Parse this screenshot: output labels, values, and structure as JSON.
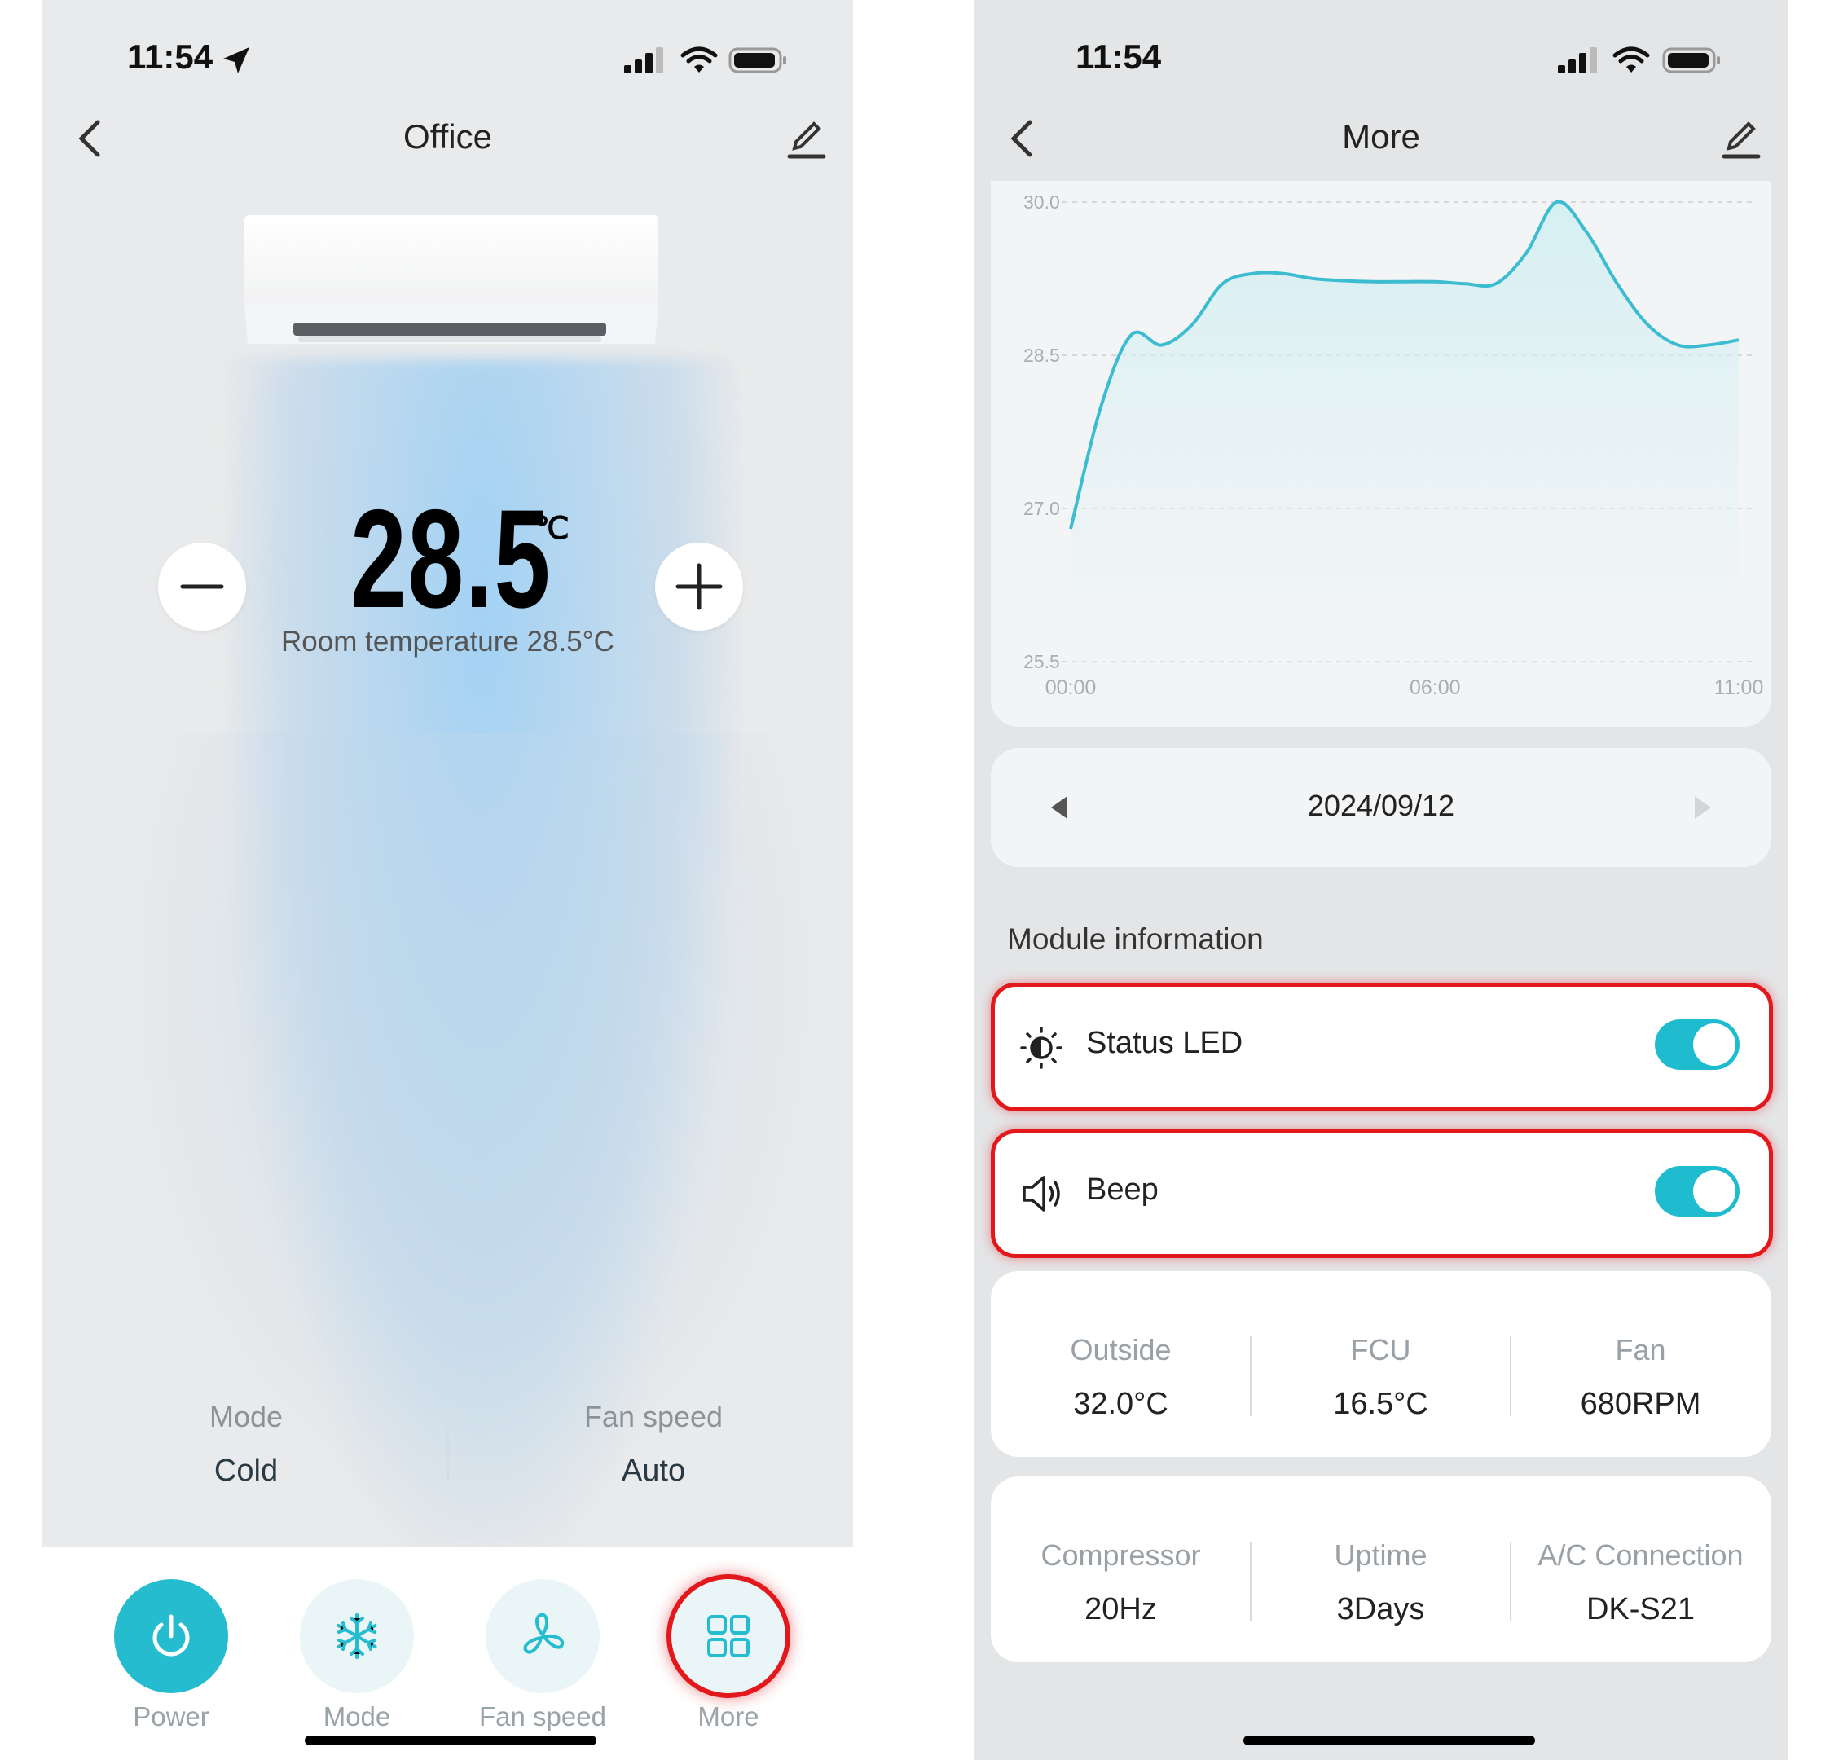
{
  "left_screen": {
    "status": {
      "time": "11:54"
    },
    "nav": {
      "title": "Office"
    },
    "setpoint": {
      "value": "28.5",
      "unit": "℃"
    },
    "room_temperature": "Room temperature 28.5°C",
    "info": [
      {
        "label": "Mode",
        "value": "Cold"
      },
      {
        "label": "Fan speed",
        "value": "Auto"
      }
    ],
    "tabs": [
      {
        "label": "Power",
        "icon": "power-icon"
      },
      {
        "label": "Mode",
        "icon": "snowflake-icon"
      },
      {
        "label": "Fan speed",
        "icon": "fan-icon"
      },
      {
        "label": "More",
        "icon": "grid-icon"
      }
    ]
  },
  "right_screen": {
    "status": {
      "time": "11:54"
    },
    "nav": {
      "title": "More"
    },
    "chart_data": {
      "type": "area",
      "x": [
        "00:00",
        "00:30",
        "01:00",
        "01:30",
        "02:00",
        "02:30",
        "03:00",
        "03:30",
        "04:00",
        "04:30",
        "05:00",
        "05:30",
        "06:00",
        "06:30",
        "07:00",
        "07:30",
        "08:00",
        "08:30",
        "09:00",
        "09:30",
        "10:00",
        "10:30",
        "11:00"
      ],
      "y_ticks": [
        "30.0",
        "28.5",
        "27.0",
        "25.5"
      ],
      "x_ticks": [
        "00:00",
        "06:00",
        "11:00"
      ],
      "ylim": [
        25.5,
        30.0
      ],
      "series": [
        {
          "values": [
            26.8,
            28.0,
            28.7,
            28.6,
            28.8,
            29.2,
            29.3,
            29.3,
            29.25,
            29.23,
            29.22,
            29.22,
            29.22,
            29.2,
            29.2,
            29.5,
            30.0,
            29.7,
            29.2,
            28.8,
            28.6,
            28.6,
            28.65
          ]
        }
      ],
      "grid": true,
      "line_color": "#3cbcd0"
    },
    "date_picker": {
      "date": "2024/09/12"
    },
    "section_title": "Module information",
    "toggles": [
      {
        "label": "Status LED",
        "icon": "brightness-icon",
        "on": true
      },
      {
        "label": "Beep",
        "icon": "speaker-icon",
        "on": true
      }
    ],
    "stats_row1": [
      {
        "label": "Outside",
        "value": "32.0°C"
      },
      {
        "label": "FCU",
        "value": "16.5°C"
      },
      {
        "label": "Fan",
        "value": "680RPM"
      }
    ],
    "stats_row2": [
      {
        "label": "Compressor",
        "value": "20Hz"
      },
      {
        "label": "Uptime",
        "value": "3Days"
      },
      {
        "label": "A/C Connection",
        "value": "DK-S21"
      }
    ]
  },
  "colors": {
    "accent": "#1fbcd0",
    "highlight": "#e3181c"
  }
}
